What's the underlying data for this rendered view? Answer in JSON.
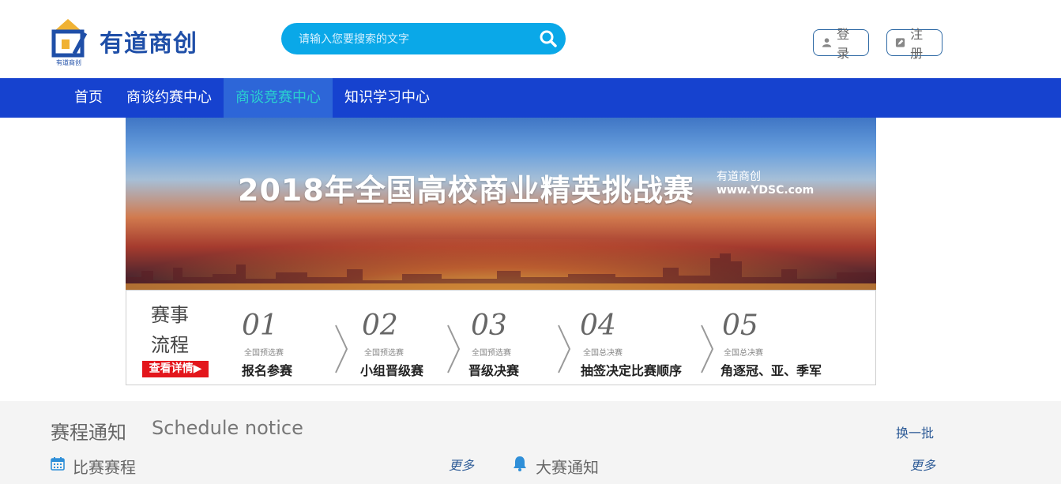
{
  "header": {
    "logo_text": "有道商创",
    "logo_subtext": "有道商创",
    "search_placeholder": "请输入您要搜索的文字",
    "login_label": "登录",
    "register_label": "注册"
  },
  "nav": {
    "items": [
      {
        "label": "首页",
        "active": false
      },
      {
        "label": "商谈约赛中心",
        "active": false
      },
      {
        "label": "商谈竞赛中心",
        "active": true
      },
      {
        "label": "知识学习中心",
        "active": false
      }
    ],
    "colors": {
      "bar": "#1642cf",
      "active_bg": "#2d66d8",
      "active_text": "#2ad0d0"
    }
  },
  "banner": {
    "title": "2018年全国高校商业精英挑战赛",
    "brand": "有道商创",
    "url": "www.YDSC.com"
  },
  "flow": {
    "title_line1": "赛事",
    "title_line2": "流程",
    "details_button": "查看详情▶",
    "steps": [
      {
        "num": "01",
        "stage": "全国预选赛",
        "label": "报名参赛"
      },
      {
        "num": "02",
        "stage": "全国预选赛",
        "label": "小组晋级赛"
      },
      {
        "num": "03",
        "stage": "全国预选赛",
        "label": "晋级决赛"
      },
      {
        "num": "04",
        "stage": "全国总决赛",
        "label": "抽签决定比赛顺序"
      },
      {
        "num": "05",
        "stage": "全国总决赛",
        "label": "角逐冠、亚、季军"
      }
    ]
  },
  "schedule": {
    "title": "赛程通知",
    "subtitle": "Schedule notice",
    "swap_label": "换一批",
    "left_heading": "比赛赛程",
    "left_more": "更多",
    "right_heading": "大赛通知",
    "right_more": "更多"
  }
}
